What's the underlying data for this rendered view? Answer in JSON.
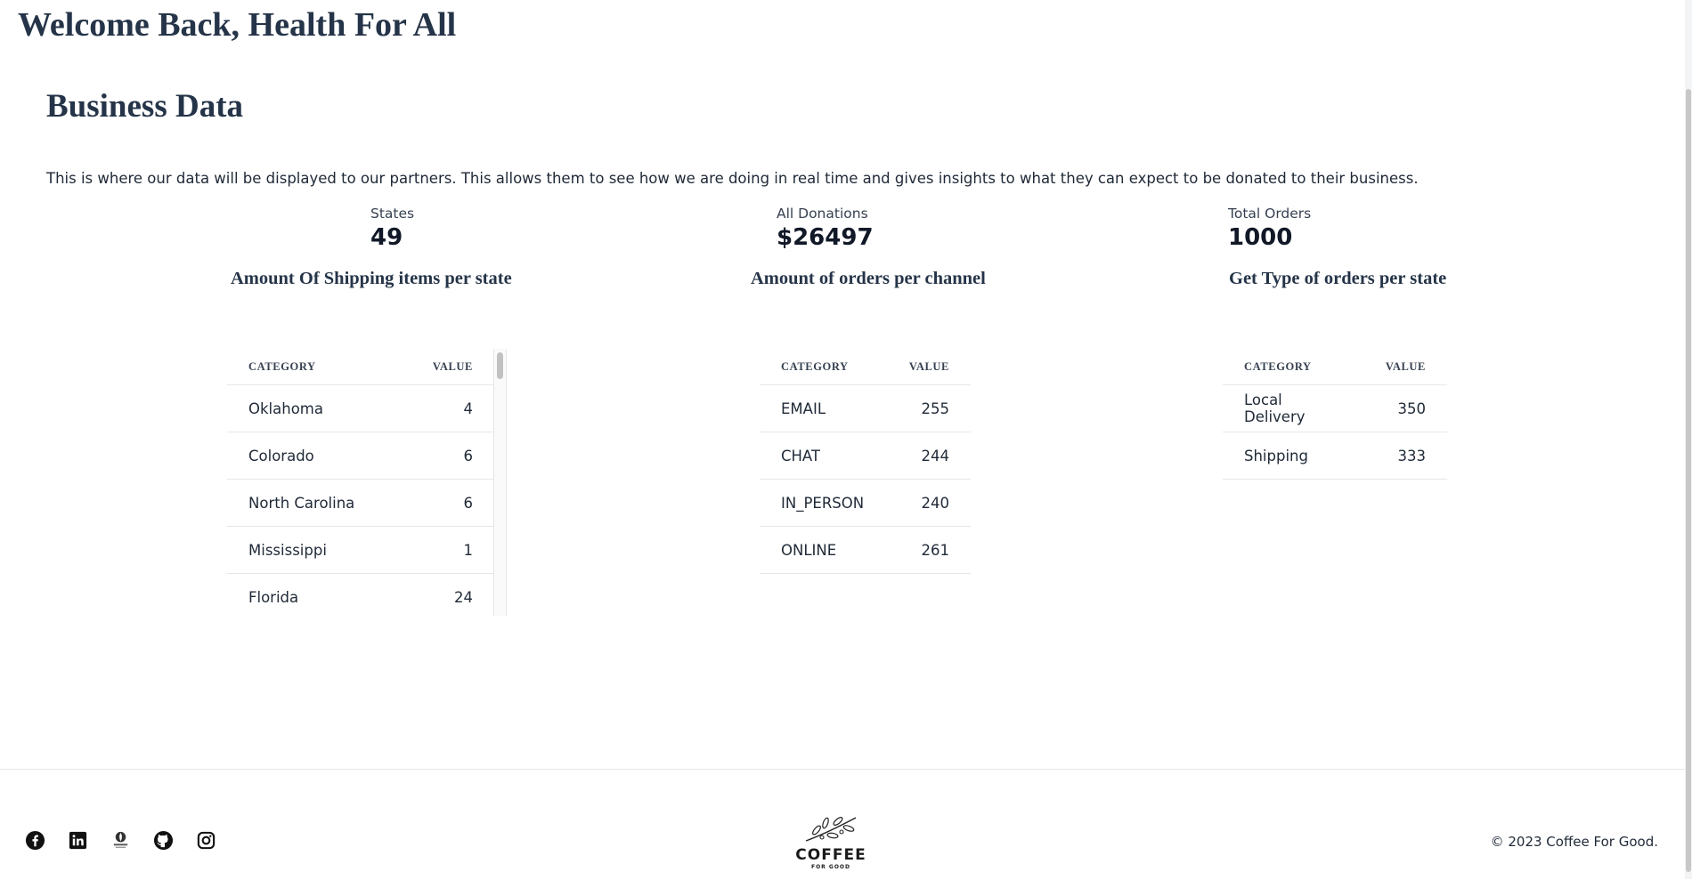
{
  "header": {
    "welcome": "Welcome Back, Health For All"
  },
  "section": {
    "title": "Business Data",
    "intro": "This is where our data will be displayed to our partners. This allows them to see how we are doing in real time and gives insights to what they can expect to be donated to their business."
  },
  "stats": [
    {
      "label": "States",
      "value": "49"
    },
    {
      "label": "All Donations",
      "value": "$26497"
    },
    {
      "label": "Total Orders",
      "value": "1000"
    }
  ],
  "tables": [
    {
      "title": "Amount Of Shipping items per state",
      "col_category": "CATEGORY",
      "col_value": "VALUE",
      "rows": [
        {
          "category": "Oklahoma",
          "value": "4"
        },
        {
          "category": "Colorado",
          "value": "6"
        },
        {
          "category": "North Carolina",
          "value": "6"
        },
        {
          "category": "Mississippi",
          "value": "1"
        },
        {
          "category": "Florida",
          "value": "24"
        }
      ]
    },
    {
      "title": "Amount of orders per channel",
      "col_category": "CATEGORY",
      "col_value": "VALUE",
      "rows": [
        {
          "category": "EMAIL",
          "value": "255"
        },
        {
          "category": "CHAT",
          "value": "244"
        },
        {
          "category": "IN_PERSON",
          "value": "240"
        },
        {
          "category": "ONLINE",
          "value": "261"
        }
      ]
    },
    {
      "title": "Get Type of orders per state",
      "col_category": "CATEGORY",
      "col_value": "VALUE",
      "rows": [
        {
          "category": "Local Delivery",
          "value": "350"
        },
        {
          "category": "Shipping",
          "value": "333"
        }
      ]
    }
  ],
  "footer": {
    "social_icons": [
      "facebook-icon",
      "linkedin-icon",
      "coffee-for-good-icon",
      "github-icon",
      "instagram-icon"
    ],
    "logo_text": "COFFEE",
    "logo_sub": "FOR GOOD",
    "copyright": "© 2023 Coffee For Good."
  }
}
